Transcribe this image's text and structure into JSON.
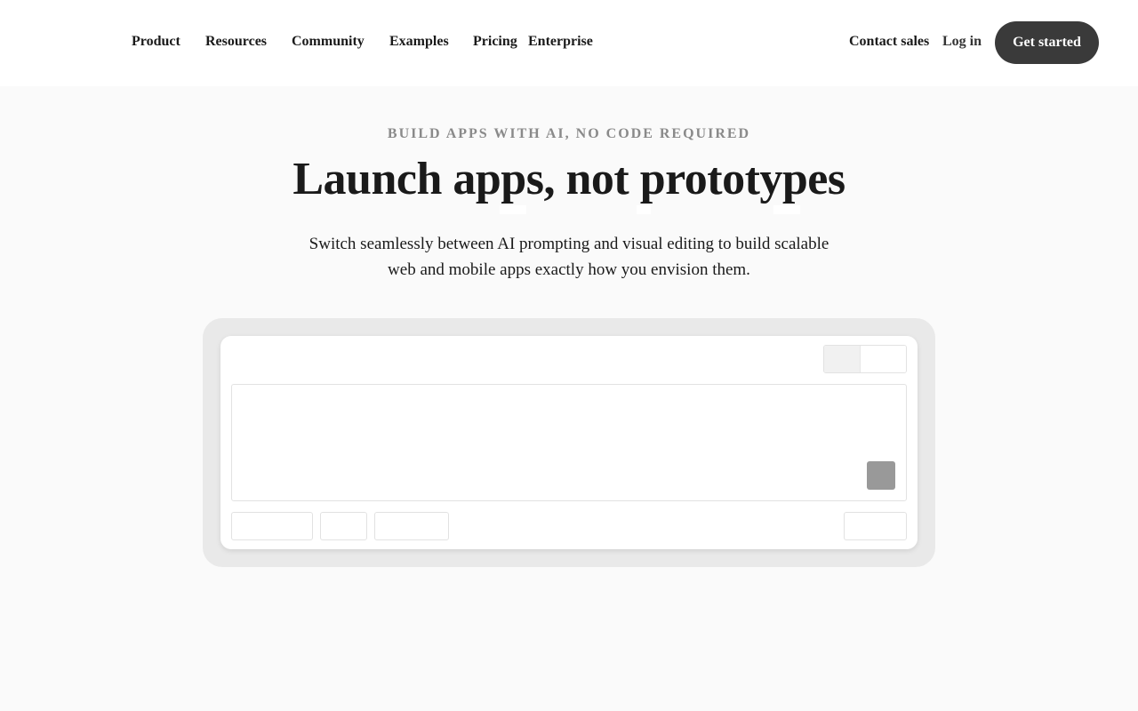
{
  "nav": {
    "links": [
      "Product",
      "Resources",
      "Community",
      "Examples",
      "Pricing",
      "Enterprise"
    ],
    "contact_sales": "Contact sales",
    "log_in": "Log in",
    "get_started": "Get started"
  },
  "hero": {
    "eyebrow": "BUILD APPS WITH AI, NO CODE REQUIRED",
    "headline": "Launch apps, not prototypes",
    "subhead_line1": "Switch seamlessly between AI prompting and visual editing to build scalable",
    "subhead_line2": "web and mobile apps exactly how you envision them."
  },
  "colors": {
    "page_bg": "#fafafa",
    "nav_bg": "#ffffff",
    "primary_button": "#3a3a3a",
    "eyebrow_text": "#8a8a8a",
    "send_button": "#999999"
  }
}
